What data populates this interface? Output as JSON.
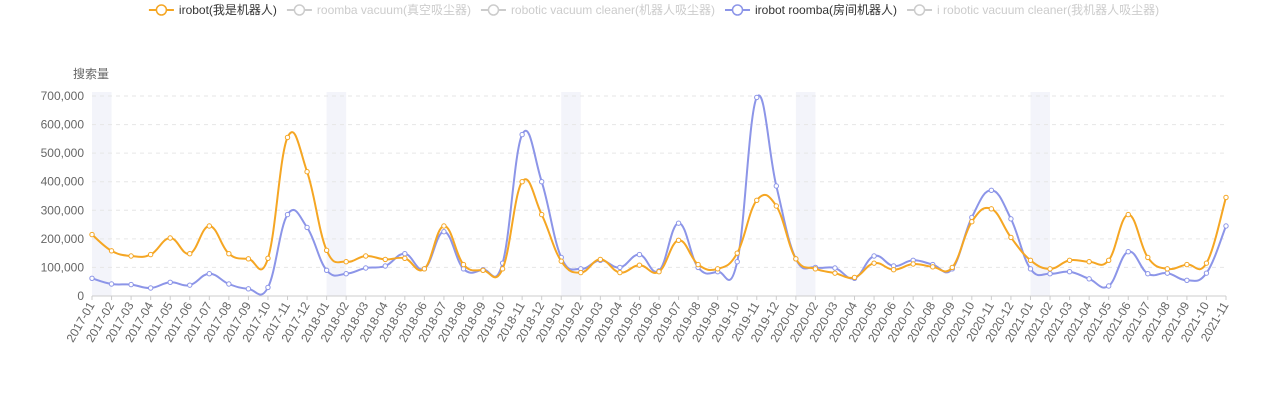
{
  "chart_data": {
    "type": "line",
    "ylabel": "搜索量",
    "ylim": [
      0,
      700000
    ],
    "y_ticks": [
      "0",
      "100,000",
      "200,000",
      "300,000",
      "400,000",
      "500,000",
      "600,000",
      "700,000"
    ],
    "grid": true,
    "legend_position": "top",
    "x": [
      "2017-01",
      "2017-02",
      "2017-03",
      "2017-04",
      "2017-05",
      "2017-06",
      "2017-07",
      "2017-08",
      "2017-09",
      "2017-10",
      "2017-11",
      "2017-12",
      "2018-01",
      "2018-02",
      "2018-03",
      "2018-04",
      "2018-05",
      "2018-06",
      "2018-07",
      "2018-08",
      "2018-09",
      "2018-10",
      "2018-11",
      "2018-12",
      "2019-01",
      "2019-02",
      "2019-03",
      "2019-04",
      "2019-05",
      "2019-06",
      "2019-07",
      "2019-08",
      "2019-09",
      "2019-10",
      "2019-11",
      "2019-12",
      "2020-01",
      "2020-02",
      "2020-03",
      "2020-04",
      "2020-05",
      "2020-06",
      "2020-07",
      "2020-08",
      "2020-09",
      "2020-10",
      "2020-11",
      "2020-12",
      "2021-01",
      "2021-02",
      "2021-03",
      "2021-04",
      "2021-05",
      "2021-06",
      "2021-07",
      "2021-08",
      "2021-09",
      "2021-10",
      "2021-11"
    ],
    "shaded_months": [
      "2017-01",
      "2018-01",
      "2019-01",
      "2020-01",
      "2021-01"
    ],
    "series": [
      {
        "name": "irobot(我是机器人)",
        "color": "#f5a623",
        "enabled": true,
        "values": [
          215000,
          158000,
          140000,
          145000,
          203000,
          148000,
          245000,
          148000,
          130000,
          132000,
          555000,
          435000,
          160000,
          120000,
          140000,
          128000,
          132000,
          95000,
          245000,
          110000,
          90000,
          95000,
          400000,
          285000,
          122000,
          82000,
          128000,
          82000,
          108000,
          85000,
          195000,
          110000,
          95000,
          150000,
          335000,
          315000,
          130000,
          95000,
          80000,
          65000,
          115000,
          92000,
          112000,
          102000,
          100000,
          260000,
          305000,
          205000,
          125000,
          95000,
          125000,
          120000,
          125000,
          285000,
          135000,
          95000,
          110000,
          115000,
          345000
        ]
      },
      {
        "name": "roomba vacuum(真空吸尘器)",
        "color": "#cccccc",
        "enabled": false,
        "values": []
      },
      {
        "name": "robotic vacuum cleaner(机器人吸尘器)",
        "color": "#cccccc",
        "enabled": false,
        "values": []
      },
      {
        "name": "irobot roomba(房间机器人)",
        "color": "#8c95e8",
        "enabled": true,
        "values": [
          62000,
          42000,
          40000,
          28000,
          48000,
          38000,
          78000,
          42000,
          25000,
          30000,
          285000,
          240000,
          90000,
          78000,
          98000,
          105000,
          148000,
          95000,
          225000,
          95000,
          92000,
          115000,
          565000,
          400000,
          135000,
          95000,
          125000,
          100000,
          145000,
          88000,
          255000,
          100000,
          85000,
          120000,
          695000,
          385000,
          130000,
          100000,
          98000,
          62000,
          140000,
          105000,
          125000,
          110000,
          95000,
          275000,
          370000,
          270000,
          95000,
          78000,
          85000,
          60000,
          35000,
          155000,
          78000,
          80000,
          55000,
          80000,
          245000
        ]
      },
      {
        "name": "i robotic vacuum cleaner(我机器人吸尘器)",
        "color": "#cccccc",
        "enabled": false,
        "values": []
      }
    ]
  }
}
